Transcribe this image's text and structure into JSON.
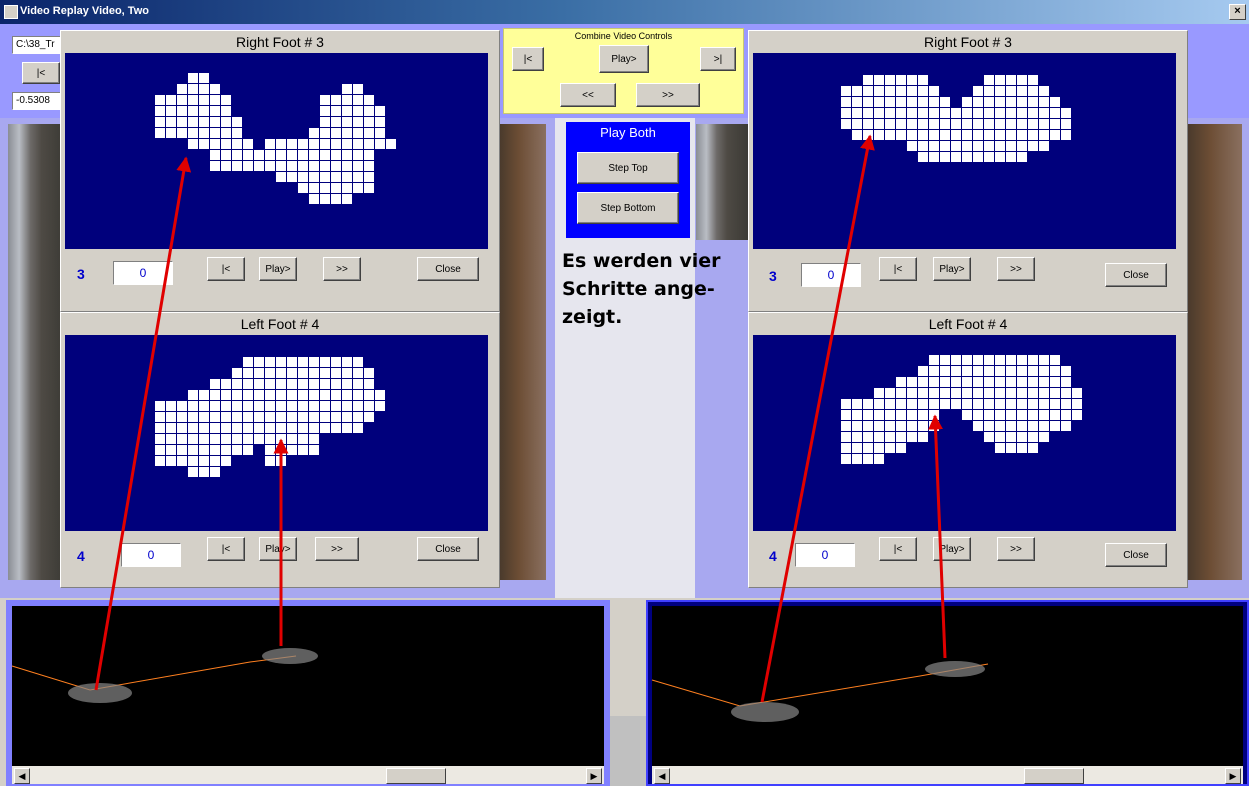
{
  "window": {
    "title": "Video Replay Video, Two",
    "close_label": "×"
  },
  "left_toolbar": {
    "path_value": "C:\\38_Tr",
    "start_label": "|<",
    "offset_value": "-0.5308"
  },
  "combine_controls": {
    "title": "Combine Video Controls",
    "start_label": "|<",
    "play_label": "Play>",
    "end_label": ">|",
    "back_label": "<<",
    "forward_label": ">>"
  },
  "play_both": {
    "title": "Play Both",
    "step_top_label": "Step Top",
    "step_bottom_label": "Step Bottom"
  },
  "annotation": {
    "line1": "Es werden vier",
    "line2": "Schritte ange-",
    "line3": "zeigt."
  },
  "panels": {
    "left_right_foot": {
      "title": "Right Foot # 3",
      "step_number": "3",
      "value": "0",
      "start_label": "|<",
      "play_label": "Play>",
      "forward_label": ">>",
      "close_label": "Close"
    },
    "left_left_foot": {
      "title": "Left Foot # 4",
      "step_number": "4",
      "value": "0",
      "start_label": "|<",
      "play_label": "Play>",
      "forward_label": ">>",
      "close_label": "Close"
    },
    "right_right_foot": {
      "title": "Right Foot # 3",
      "step_number": "3",
      "value": "0",
      "start_label": "|<",
      "play_label": "Play>",
      "forward_label": ">>",
      "close_label": "Close"
    },
    "right_left_foot": {
      "title": "Left Foot # 4",
      "step_number": "4",
      "value": "0",
      "start_label": "|<",
      "play_label": "Play>",
      "forward_label": ">>",
      "close_label": "Close"
    }
  },
  "scrollbars": {
    "left_arrow": "◀",
    "right_arrow": "▶"
  },
  "colors": {
    "footprint_bg": "#00007c",
    "footprint_cell": "#ffffff",
    "arrow": "#e00000",
    "track_line": "#ff8020",
    "play_both_bg": "#0000ff",
    "combine_bg": "#ffff99"
  }
}
